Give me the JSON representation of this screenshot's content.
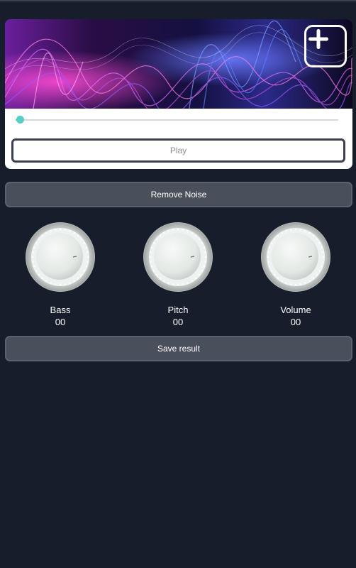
{
  "player": {
    "add_icon": "plus-icon",
    "banner": "abstract-wave-artwork",
    "progress": 0.0,
    "play_label": "Play"
  },
  "actions": {
    "remove_noise_label": "Remove Noise",
    "save_result_label": "Save result"
  },
  "knobs": [
    {
      "label": "Bass",
      "value": "00"
    },
    {
      "label": "Pitch",
      "value": "00"
    },
    {
      "label": "Volume",
      "value": "00"
    }
  ],
  "colors": {
    "background": "#161e2b",
    "button": "#4a505b",
    "accent": "#55cfc3",
    "card": "#ffffff"
  }
}
